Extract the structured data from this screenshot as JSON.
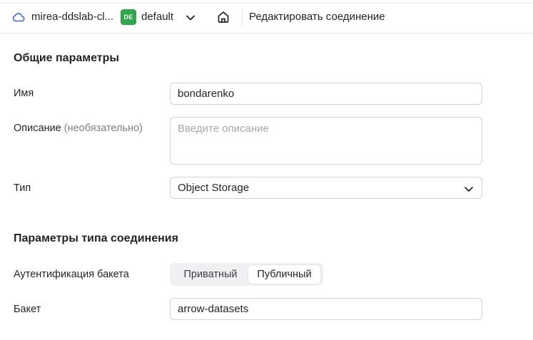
{
  "header": {
    "cloud_name": "mirea-ddslab-cl...",
    "folder_badge": "DE",
    "folder_name": "default",
    "page_title": "Редактировать соединение"
  },
  "general": {
    "title": "Общие параметры",
    "name_label": "Имя",
    "name_value": "bondarenko",
    "description_label": "Описание",
    "description_optional": "(необязательно)",
    "description_placeholder": "Введите описание",
    "type_label": "Тип",
    "type_value": "Object Storage"
  },
  "connection": {
    "title": "Параметры типа соединения",
    "auth_label": "Аутентификация бакета",
    "auth_options": [
      "Приватный",
      "Публичный"
    ],
    "auth_selected": "Публичный",
    "bucket_label": "Бакет",
    "bucket_value": "arrow-datasets"
  },
  "colors": {
    "badge": "#2ea84a",
    "icon_blue": "#3a64d8"
  },
  "icons": [
    "cloud-icon",
    "chevron-down-icon",
    "home-icon"
  ]
}
